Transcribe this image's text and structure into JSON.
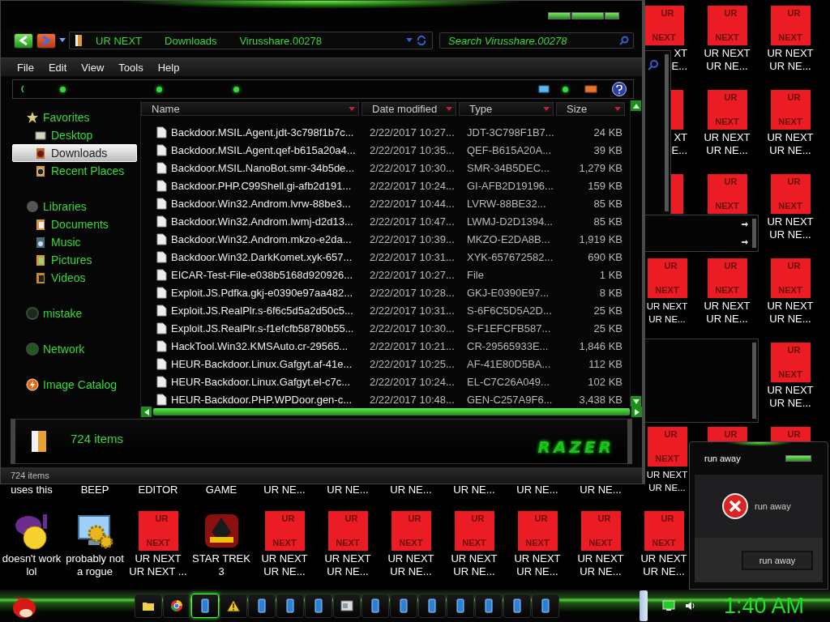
{
  "explorer": {
    "breadcrumbs": [
      "UR NEXT",
      "Downloads",
      "Virusshare.00278"
    ],
    "search": {
      "placeholder": "Search Virusshare.00278"
    },
    "menu": [
      "File",
      "Edit",
      "View",
      "Tools",
      "Help"
    ],
    "sidebar": [
      {
        "label": "Favorites",
        "kind": "star",
        "selected": false,
        "children": [
          {
            "label": "Desktop",
            "kind": "desktop",
            "selected": false
          },
          {
            "label": "Downloads",
            "kind": "download",
            "selected": true
          },
          {
            "label": "Recent Places",
            "kind": "recent",
            "selected": false
          }
        ]
      },
      {
        "label": "Libraries",
        "kind": "disc",
        "selected": false,
        "children": [
          {
            "label": "Documents",
            "kind": "documents",
            "selected": false
          },
          {
            "label": "Music",
            "kind": "music",
            "selected": false
          },
          {
            "label": "Pictures",
            "kind": "pictures",
            "selected": false
          },
          {
            "label": "Videos",
            "kind": "videos",
            "selected": false
          }
        ]
      },
      {
        "label": "mistake",
        "kind": "homegroup",
        "selected": false
      },
      {
        "label": "Network",
        "kind": "network",
        "selected": false
      },
      {
        "label": "Image Catalog",
        "kind": "catalog",
        "selected": false
      }
    ],
    "columns": [
      "Name",
      "Date modified",
      "Type",
      "Size"
    ],
    "rows": [
      {
        "name": "Backdoor.MSIL.Agent.jdt-3c798f1b7c...",
        "date": "2/22/2017 10:27...",
        "type": "JDT-3C798F1B7...",
        "size": "24 KB"
      },
      {
        "name": "Backdoor.MSIL.Agent.qef-b615a20a4...",
        "date": "2/22/2017 10:35...",
        "type": "QEF-B615A20A...",
        "size": "39 KB"
      },
      {
        "name": "Backdoor.MSIL.NanoBot.smr-34b5de...",
        "date": "2/22/2017 10:30...",
        "type": "SMR-34B5DEC...",
        "size": "1,279 KB"
      },
      {
        "name": "Backdoor.PHP.C99Shell.gi-afb2d191...",
        "date": "2/22/2017 10:24...",
        "type": "GI-AFB2D19196...",
        "size": "159 KB"
      },
      {
        "name": "Backdoor.Win32.Androm.lvrw-88be3...",
        "date": "2/22/2017 10:44...",
        "type": "LVRW-88BE32...",
        "size": "85 KB"
      },
      {
        "name": "Backdoor.Win32.Androm.lwmj-d2d13...",
        "date": "2/22/2017 10:47...",
        "type": "LWMJ-D2D1394...",
        "size": "85 KB"
      },
      {
        "name": "Backdoor.Win32.Androm.mkzo-e2da...",
        "date": "2/22/2017 10:39...",
        "type": "MKZO-E2DA8B...",
        "size": "1,919 KB"
      },
      {
        "name": "Backdoor.Win32.DarkKomet.xyk-657...",
        "date": "2/22/2017 10:31...",
        "type": "XYK-657672582...",
        "size": "690 KB"
      },
      {
        "name": "EICAR-Test-File-e038b5168d920926...",
        "date": "2/22/2017 10:27...",
        "type": "File",
        "size": "1 KB"
      },
      {
        "name": "Exploit.JS.Pdfka.gkj-e0390e97aa482...",
        "date": "2/22/2017 10:28...",
        "type": "GKJ-E0390E97...",
        "size": "8 KB"
      },
      {
        "name": "Exploit.JS.RealPlr.s-6f6c5d5a2d50c5...",
        "date": "2/22/2017 10:31...",
        "type": "S-6F6C5D5A2D...",
        "size": "25 KB"
      },
      {
        "name": "Exploit.JS.RealPlr.s-f1efcfb58780b55...",
        "date": "2/22/2017 10:30...",
        "type": "S-F1EFCFB587...",
        "size": "25 KB"
      },
      {
        "name": "HackTool.Win32.KMSAuto.cr-29565...",
        "date": "2/22/2017 10:21...",
        "type": "CR-29565933E...",
        "size": "1,846 KB"
      },
      {
        "name": "HEUR-Backdoor.Linux.Gafgyt.af-41e...",
        "date": "2/22/2017 10:25...",
        "type": "AF-41E80D5BA...",
        "size": "112 KB"
      },
      {
        "name": "HEUR-Backdoor.Linux.Gafgyt.el-c7c...",
        "date": "2/22/2017 10:24...",
        "type": "EL-C7C26A049...",
        "size": "102 KB"
      },
      {
        "name": "HEUR-Backdoor.PHP.WPDoor.gen-c...",
        "date": "2/22/2017 10:48...",
        "type": "GEN-C257A9F6...",
        "size": "3,438 KB"
      }
    ],
    "details": {
      "count": "724 items",
      "logo": "RAZER"
    },
    "status": "724 items"
  },
  "desktop": [
    {
      "kind": "tile_cut",
      "tile": [
        "UR",
        "NEXT"
      ],
      "label": [
        "XT",
        "E..."
      ]
    },
    {
      "kind": "tile",
      "tile": [
        "UR",
        "NEXT"
      ],
      "label": [
        "UR NEXT",
        "UR NE..."
      ]
    },
    {
      "kind": "tile",
      "tile": [
        "UR",
        "NEXT"
      ],
      "label": [
        "UR NEXT",
        "UR NE..."
      ]
    },
    {
      "kind": "sliver",
      "label": [
        "XT",
        "E..."
      ]
    },
    {
      "kind": "tile",
      "tile": [
        "UR",
        "NEXT"
      ],
      "label": [
        "UR NEXT",
        "UR NE..."
      ]
    },
    {
      "kind": "tile",
      "tile": [
        "UR",
        "NEXT"
      ],
      "label": [
        "UR NEXT",
        "UR NE..."
      ]
    },
    {
      "kind": "sliver"
    },
    {
      "kind": "tile",
      "tile": [
        "UR",
        "NEXT"
      ]
    },
    {
      "kind": "tile",
      "tile": [
        "UR",
        "NEXT"
      ],
      "label": [
        "UR NEXT",
        "UR NE..."
      ]
    },
    {
      "kind": "tile",
      "tile": [
        "UR",
        "NEXT"
      ],
      "label": [
        "UR NEXT",
        "UR NE..."
      ]
    },
    {
      "kind": "tile",
      "tile": [
        "UR",
        "NEXT"
      ],
      "label": [
        "UR NEXT",
        "UR NE..."
      ]
    },
    {
      "kind": "tile",
      "tile": [
        "UR",
        "NEXT"
      ],
      "label": [
        "UR NEXT",
        "UR NE..."
      ]
    },
    {
      "kind": "tile",
      "tile": [
        "UR",
        "NEXT"
      ],
      "label": [
        "UR NEXT",
        "UR NE..."
      ]
    },
    {
      "kind": "tail",
      "label": [
        "uses this"
      ]
    },
    {
      "kind": "tail",
      "label": [
        "BEEP"
      ]
    },
    {
      "kind": "tail",
      "label": [
        "EDITOR"
      ]
    },
    {
      "kind": "tail",
      "label": [
        "GAME"
      ]
    },
    {
      "kind": "tail",
      "label": [
        "UR NE..."
      ]
    },
    {
      "kind": "tail",
      "label": [
        "UR NE..."
      ]
    },
    {
      "kind": "tail",
      "label": [
        "UR NE..."
      ]
    },
    {
      "kind": "tail",
      "label": [
        "UR NE..."
      ]
    },
    {
      "kind": "tail",
      "label": [
        "UR NE..."
      ]
    },
    {
      "kind": "tail",
      "label": [
        "UR NE..."
      ]
    },
    {
      "kind": "tile",
      "tile": [
        "UR",
        "NEXT"
      ],
      "label": [
        "UR NEXT",
        "UR NE..."
      ]
    },
    {
      "kind": "tile",
      "tile": [
        "UR"
      ]
    },
    {
      "kind": "tile",
      "tile": [
        "UR"
      ]
    },
    {
      "kind": "messenger",
      "label": [
        "doesn't work",
        "lol"
      ]
    },
    {
      "kind": "gears",
      "label": [
        "probably not",
        "a rogue"
      ]
    },
    {
      "kind": "tile",
      "tile": [
        "UR",
        "NEXT"
      ],
      "label": [
        "UR NEXT",
        "UR NEXT ..."
      ]
    },
    {
      "kind": "game",
      "label": [
        "STAR TREK",
        "3"
      ]
    },
    {
      "kind": "tile",
      "tile": [
        "UR",
        "NEXT"
      ],
      "label": [
        "UR NEXT",
        "UR NE..."
      ]
    },
    {
      "kind": "tile",
      "tile": [
        "UR",
        "NEXT"
      ],
      "label": [
        "UR NEXT",
        "UR NE..."
      ]
    },
    {
      "kind": "tile",
      "tile": [
        "UR",
        "NEXT"
      ],
      "label": [
        "UR NEXT",
        "UR NE..."
      ]
    },
    {
      "kind": "tile",
      "tile": [
        "UR",
        "NEXT"
      ],
      "label": [
        "UR NEXT",
        "UR NE..."
      ]
    },
    {
      "kind": "tile",
      "tile": [
        "UR",
        "NEXT"
      ],
      "label": [
        "UR NEXT",
        "UR NE..."
      ]
    },
    {
      "kind": "tile",
      "tile": [
        "UR",
        "NEXT"
      ],
      "label": [
        "UR NEXT",
        "UR NE..."
      ]
    },
    {
      "kind": "tile",
      "tile": [
        "UR",
        "NEXT"
      ],
      "label": [
        "UR NEXT",
        "UR NE..."
      ]
    }
  ],
  "dialog": {
    "title": "run away",
    "message": "run away",
    "button": "run away"
  },
  "taskbar": {
    "items": [
      {
        "kind": "folder",
        "selected": false
      },
      {
        "kind": "browser",
        "selected": false
      },
      {
        "kind": "app",
        "selected": true
      },
      {
        "kind": "warning",
        "selected": false
      },
      {
        "kind": "app",
        "selected": false
      },
      {
        "kind": "app",
        "selected": false
      },
      {
        "kind": "app",
        "selected": false
      },
      {
        "kind": "window",
        "selected": false
      },
      {
        "kind": "app",
        "selected": false
      },
      {
        "kind": "app",
        "selected": false
      },
      {
        "kind": "app",
        "selected": false
      },
      {
        "kind": "app",
        "selected": false
      },
      {
        "kind": "app",
        "selected": false
      },
      {
        "kind": "app",
        "selected": false
      },
      {
        "kind": "app",
        "selected": false
      }
    ],
    "clock": "1:40 AM"
  }
}
